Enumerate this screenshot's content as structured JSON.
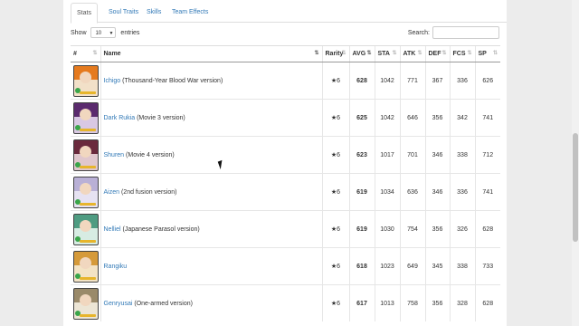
{
  "tabs": [
    {
      "label": "Stats",
      "active": true
    },
    {
      "label": "Soul Traits",
      "active": false
    },
    {
      "label": "Skills",
      "active": false
    },
    {
      "label": "Team Effects",
      "active": false
    }
  ],
  "length_control": {
    "prefix": "Show",
    "value": "10",
    "suffix": "entries"
  },
  "search": {
    "label": "Search:",
    "value": ""
  },
  "table": {
    "headers": [
      "#",
      "Name",
      "Rarity",
      "AVG",
      "STA",
      "ATK",
      "DEF",
      "FCS",
      "SP"
    ],
    "rows": [
      {
        "name": "Ichigo",
        "version": "(Thousand-Year Blood War version)",
        "rarity": "★6",
        "avg": "628",
        "sta": "1042",
        "atk": "771",
        "def": "367",
        "fcs": "336",
        "sp": "626",
        "colors": {
          "hair": "#e57a1e",
          "bg": "#f2e0c8"
        }
      },
      {
        "name": "Dark Rukia",
        "version": "(Movie 3 version)",
        "rarity": "★6",
        "avg": "625",
        "sta": "1042",
        "atk": "646",
        "def": "356",
        "fcs": "342",
        "sp": "741",
        "colors": {
          "hair": "#5b2b6e",
          "bg": "#d9c8e3"
        }
      },
      {
        "name": "Shuren",
        "version": "(Movie 4 version)",
        "rarity": "★6",
        "avg": "623",
        "sta": "1017",
        "atk": "701",
        "def": "346",
        "fcs": "338",
        "sp": "712",
        "colors": {
          "hair": "#6a2a3d",
          "bg": "#e0c7cd"
        }
      },
      {
        "name": "Aizen",
        "version": "(2nd fusion version)",
        "rarity": "★6",
        "avg": "619",
        "sta": "1034",
        "atk": "636",
        "def": "346",
        "fcs": "336",
        "sp": "741",
        "colors": {
          "hair": "#b9b0d6",
          "bg": "#e6e2f2"
        }
      },
      {
        "name": "Nelliel",
        "version": "(Japanese Parasol version)",
        "rarity": "★6",
        "avg": "619",
        "sta": "1030",
        "atk": "754",
        "def": "356",
        "fcs": "326",
        "sp": "628",
        "colors": {
          "hair": "#4f9c82",
          "bg": "#d7ece3"
        }
      },
      {
        "name": "Rangiku",
        "version": "",
        "rarity": "★6",
        "avg": "618",
        "sta": "1023",
        "atk": "649",
        "def": "345",
        "fcs": "338",
        "sp": "733",
        "colors": {
          "hair": "#d59a3a",
          "bg": "#f3e3c5"
        }
      },
      {
        "name": "Genryusai",
        "version": "(One-armed version)",
        "rarity": "★6",
        "avg": "617",
        "sta": "1013",
        "atk": "758",
        "def": "356",
        "fcs": "328",
        "sp": "628",
        "colors": {
          "hair": "#9a8a6a",
          "bg": "#ece5d5"
        }
      }
    ]
  },
  "colors": {
    "link": "#337ab7",
    "star_bar": "#e7b52c",
    "badge": "#3aa54a"
  }
}
